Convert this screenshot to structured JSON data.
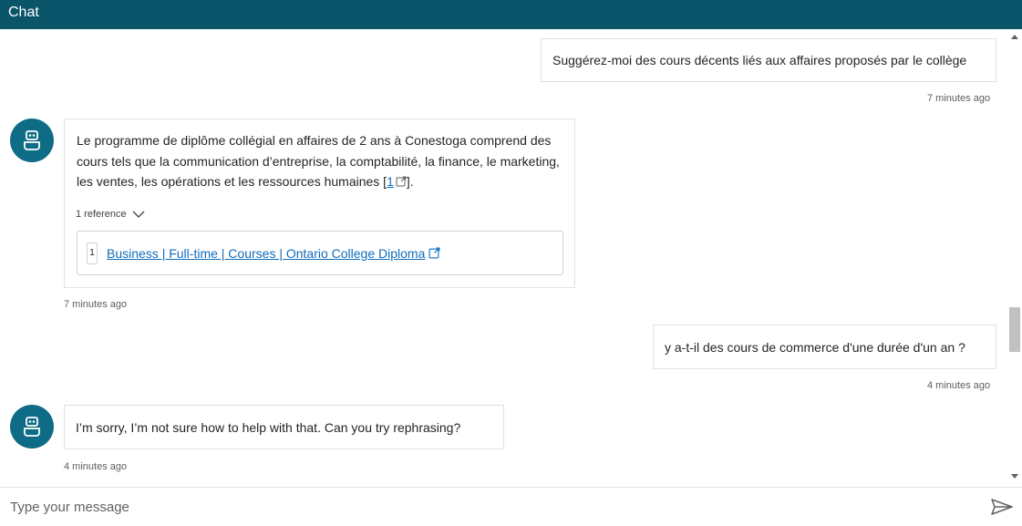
{
  "header": {
    "title": "Chat"
  },
  "messages": [
    {
      "role": "user",
      "text": "Suggérez-moi des cours décents liés aux affaires proposés par le collège",
      "time": "7 minutes ago"
    },
    {
      "role": "bot",
      "text": "Le programme de diplôme collégial en affaires de 2 ans à Conestoga comprend des cours tels que la communication d’entreprise, la comptabilité, la finance, le marketing, les ventes, les opérations et les ressources humaines ",
      "citation": "1",
      "after": "].",
      "ref_toggle": "1 reference",
      "reference": {
        "index": "1",
        "title": "Business | Full-time | Courses | Ontario College Diploma"
      },
      "time": "7 minutes ago"
    },
    {
      "role": "user",
      "text": "y a-t-il des cours de commerce d'une durée d'un an ?",
      "time": "4 minutes ago"
    },
    {
      "role": "bot",
      "text": "I’m sorry, I’m not sure how to help with that. Can you try rephrasing?",
      "time": "4 minutes ago"
    }
  ],
  "input": {
    "placeholder": "Type your message"
  },
  "icons": {
    "avatar": "bot-icon",
    "send": "send-icon",
    "external": "external-link-icon",
    "toggle": "chevron-down-icon"
  },
  "colors": {
    "header": "#0b556a",
    "avatar": "#0e6c86",
    "link": "#0f6cbd"
  }
}
